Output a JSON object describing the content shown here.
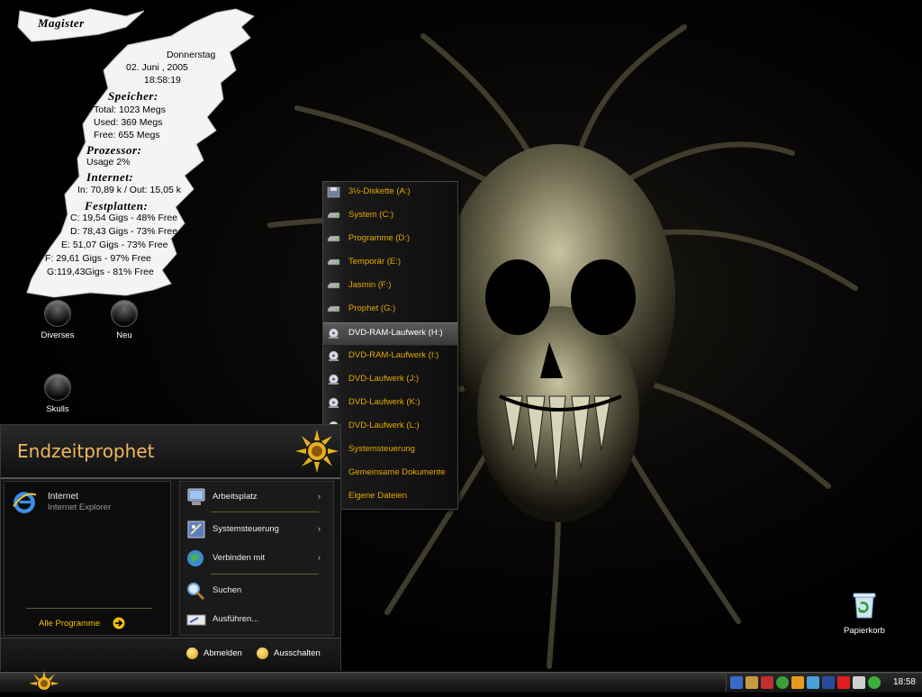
{
  "samurize": {
    "title": "Magister",
    "day": "Donnerstag",
    "date": "02. Juni , 2005",
    "time": "18:58:19",
    "memory_heading": "Speicher:",
    "mem_total": "Total: 1023 Megs",
    "mem_used": "Used: 369 Megs",
    "mem_free": "Free: 655 Megs",
    "cpu_heading": "Prozessor:",
    "cpu_usage": "Usage 2%",
    "net_heading": "Internet:",
    "net_line": "In: 70,89 k /   Out: 15,05 k",
    "disks_heading": "Festplatten:",
    "disks": [
      "C: 19,54 Gigs - 48% Free",
      "D: 78,43 Gigs - 73% Free",
      "E: 51,07 Gigs - 73% Free",
      "F: 29,61 Gigs - 97% Free",
      "G:119,43Gigs - 81% Free"
    ]
  },
  "desktop_icons": [
    {
      "label": "Diverses"
    },
    {
      "label": "Neu"
    },
    {
      "label": "Skulls"
    },
    {
      "label": "Papierkorb"
    }
  ],
  "drive_menu": {
    "items": [
      {
        "label": "3½-Diskette (A:)",
        "icon": "floppy-icon"
      },
      {
        "label": "System (C:)",
        "icon": "hard-drive-icon"
      },
      {
        "label": "Programme (D:)",
        "icon": "hard-drive-icon"
      },
      {
        "label": "Temporär (E:)",
        "icon": "hard-drive-icon"
      },
      {
        "label": "Jasmin (F:)",
        "icon": "hard-drive-icon"
      },
      {
        "label": "Prophet (G:)",
        "icon": "hard-drive-icon"
      },
      {
        "label": "DVD-RAM-Laufwerk (H:)",
        "icon": "dvd-drive-icon",
        "selected": true
      },
      {
        "label": "DVD-RAM-Laufwerk (I:)",
        "icon": "dvd-drive-icon"
      },
      {
        "label": "DVD-Laufwerk (J:)",
        "icon": "dvd-drive-icon"
      },
      {
        "label": "DVD-Laufwerk (K:)",
        "icon": "dvd-drive-icon"
      },
      {
        "label": "DVD-Laufwerk (L:)",
        "icon": "dvd-drive-icon"
      },
      {
        "label": "Systemsteuerung",
        "icon": "control-panel-icon"
      },
      {
        "label": "Gemeinsame Dokumente",
        "icon": "folder-icon"
      },
      {
        "label": "Eigene Dateien",
        "icon": "folder-icon"
      }
    ]
  },
  "start_menu": {
    "user": "Endzeitprophet",
    "pinned": {
      "title": "Internet",
      "subtitle": "Internet Explorer"
    },
    "all_programs": "Alle Programme",
    "right_items": [
      {
        "label": "Arbeitsplatz",
        "arrow": "›"
      },
      {
        "label": "Systemsteuerung",
        "arrow": "›"
      },
      {
        "label": "Verbinden mit",
        "arrow": "›"
      },
      {
        "label": "Suchen"
      },
      {
        "label": "Ausführen..."
      }
    ],
    "logoff": "Abmelden",
    "shutdown": "Ausschalten"
  },
  "taskbar": {
    "clock": "18:58",
    "accent": "#e8a800"
  }
}
